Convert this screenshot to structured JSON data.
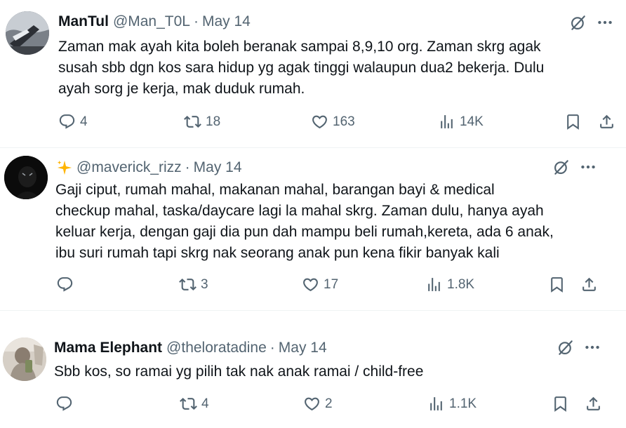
{
  "tweets": [
    {
      "author_name": "ManTul",
      "handle": "@Man_T0L",
      "separator": "·",
      "date": "May 14",
      "lines": [
        "Zaman mak ayah kita boleh beranak sampai 8,9,10 org. Zaman skrg agak",
        "susah sbb dgn kos sara hidup yg agak tinggi walaupun dua2 bekerja. Dulu",
        "ayah sorg je kerja, mak duduk rumah."
      ],
      "replies": "4",
      "reposts": "18",
      "likes": "163",
      "views": "14K"
    },
    {
      "author_name": "",
      "handle": "@maverick_rizz",
      "separator": "·",
      "date": "May 14",
      "lines": [
        "Gaji ciput, rumah mahal, makanan mahal, barangan bayi & medical",
        "checkup mahal, taska/daycare lagi la mahal skrg. Zaman dulu, hanya ayah",
        "keluar kerja, dengan gaji dia pun dah mampu beli rumah,kereta, ada 6 anak,",
        "ibu suri rumah tapi skrg nak seorang anak pun kena fikir banyak kali"
      ],
      "replies": "",
      "reposts": "3",
      "likes": "17",
      "views": "1.8K"
    },
    {
      "author_name": "Mama Elephant",
      "handle": "@theloratadine",
      "separator": "·",
      "date": "May 14",
      "lines": [
        "Sbb kos, so ramai yg pilih tak nak anak ramai / child-free"
      ],
      "replies": "",
      "reposts": "4",
      "likes": "2",
      "views": "1.1K"
    }
  ],
  "icons": {
    "reply": "speech-bubble-icon",
    "repost": "repost-arrows-icon",
    "like": "heart-icon",
    "views": "bar-chart-icon",
    "bookmark": "bookmark-icon",
    "share": "share-upload-icon",
    "grok": "grok-slash-circle-icon",
    "more": "more-dots-icon",
    "sparkle": "sparkle-emoji-icon"
  },
  "colors": {
    "text": "#0f1419",
    "secondary": "#536471",
    "divider": "#eff3f4",
    "sparkle": "#ffb400"
  }
}
